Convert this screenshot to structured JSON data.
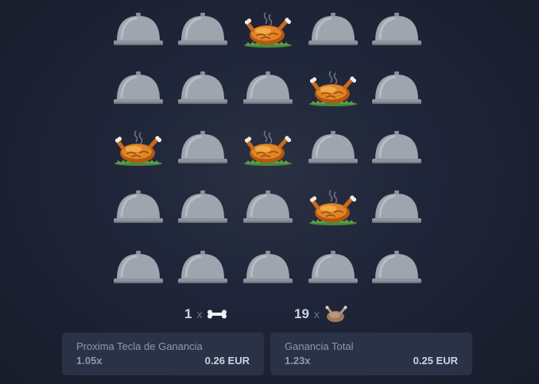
{
  "grid": {
    "rows": 5,
    "cols": 5,
    "cells": [
      [
        "cloche",
        "cloche",
        "chicken",
        "cloche",
        "cloche"
      ],
      [
        "cloche",
        "cloche",
        "cloche",
        "chicken",
        "cloche"
      ],
      [
        "chicken",
        "cloche",
        "chicken",
        "cloche",
        "cloche"
      ],
      [
        "cloche",
        "cloche",
        "cloche",
        "chicken",
        "cloche"
      ],
      [
        "cloche",
        "cloche",
        "cloche",
        "cloche",
        "cloche"
      ]
    ]
  },
  "stats": {
    "bones": {
      "count": "1",
      "times": "x",
      "icon": "bone-icon"
    },
    "chickens": {
      "count": "19",
      "times": "x",
      "icon": "roast-chicken-icon"
    }
  },
  "next_win": {
    "label": "Proxima Tecla de Ganancia",
    "multiplier": "1.05x",
    "amount": "0.26 EUR"
  },
  "total_win": {
    "label": "Ganancia Total",
    "multiplier": "1.23x",
    "amount": "0.25 EUR"
  },
  "colors": {
    "background": "#20263a",
    "panel": "#2b3245",
    "cloche": "#9fa4ae",
    "chicken": "#e0862a",
    "text_muted": "#8e98ac",
    "text_value": "#c9d3e6"
  }
}
